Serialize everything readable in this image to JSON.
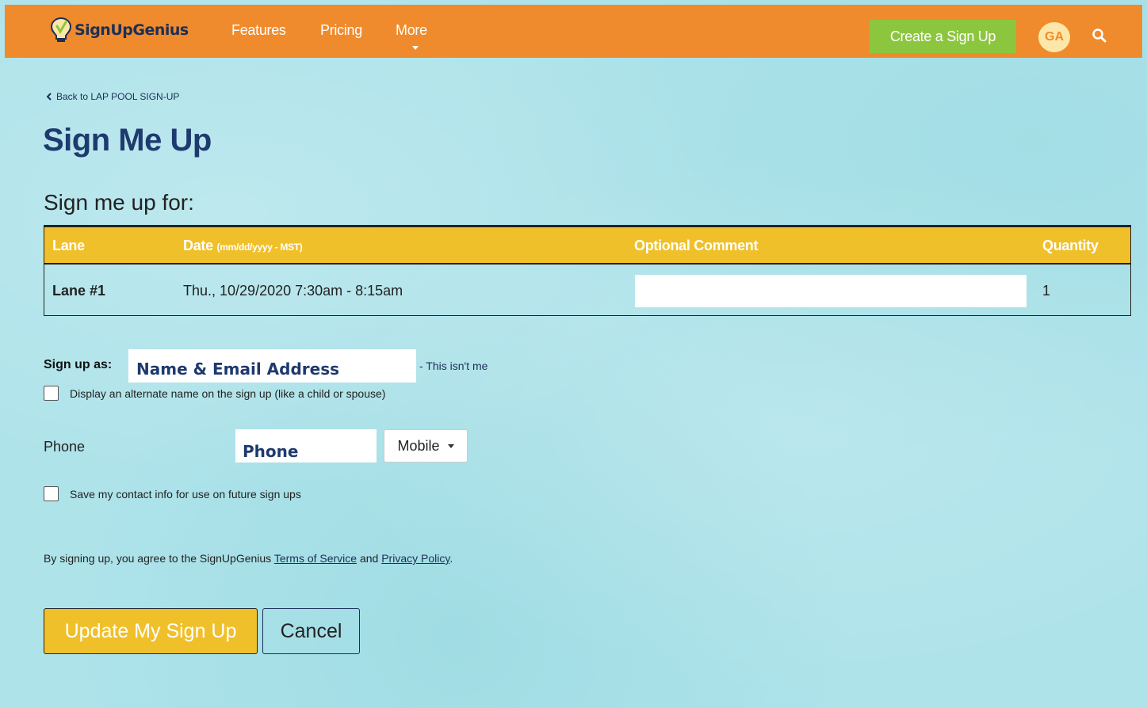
{
  "header": {
    "logo_text": "SignUpGenius",
    "nav": [
      {
        "label": "Features"
      },
      {
        "label": "Pricing"
      },
      {
        "label": "More"
      }
    ],
    "create_button": "Create a Sign Up",
    "avatar_initials": "GA",
    "accent_color": "#ef8b2c",
    "create_color": "#8cc63f"
  },
  "back_link": "Back to LAP POOL SIGN-UP",
  "page_title": "Sign Me Up",
  "section_title": "Sign me up for:",
  "table": {
    "headers": {
      "lane": "Lane",
      "date": "Date",
      "date_note": "(mm/dd/yyyy - MST)",
      "comment": "Optional Comment",
      "quantity": "Quantity"
    },
    "rows": [
      {
        "lane": "Lane #1",
        "date": "Thu., 10/29/2020 7:30am - 8:15am",
        "comment": "",
        "quantity": "1"
      }
    ],
    "header_color": "#f0c02a"
  },
  "signup_as": {
    "label": "Sign up as:",
    "name_value": "Name & Email Address",
    "not_me": "- This isn't me"
  },
  "alternate_name_checkbox": {
    "label": "Display an alternate name on the sign up (like a child or spouse)",
    "checked": false
  },
  "phone": {
    "label": "Phone",
    "value": "Phone",
    "type": "Mobile"
  },
  "save_contact_checkbox": {
    "label": "Save my contact info for use on future sign ups",
    "checked": false
  },
  "terms": {
    "prefix": "By signing up, you agree to the SignUpGenius ",
    "tos": "Terms of Service",
    "and": " and ",
    "privacy": "Privacy Policy",
    "suffix": "."
  },
  "buttons": {
    "submit": "Update My Sign Up",
    "cancel": "Cancel"
  }
}
